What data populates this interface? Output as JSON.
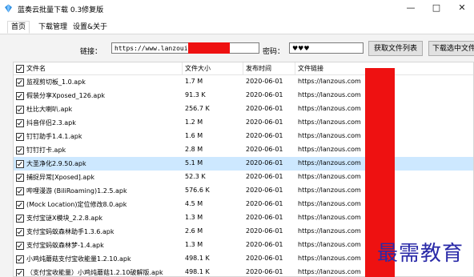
{
  "window": {
    "title": "蓝奏云批量下载 0.3修复版",
    "minimize_glyph": "—",
    "maximize_glyph": "□",
    "close_glyph": "✕"
  },
  "tabs": [
    {
      "label": "首页",
      "active": true
    },
    {
      "label": "下载管理",
      "active": false
    },
    {
      "label": "设置&关于",
      "active": false
    }
  ],
  "form": {
    "link_label": "链接：",
    "link_value": "https://www.lanzoui.com",
    "password_label": "密码：",
    "password_value": "♥♥♥",
    "get_list_button": "获取文件列表",
    "download_selected_button": "下载选中文件"
  },
  "table": {
    "headers": {
      "name": "文件名",
      "size": "文件大小",
      "date": "发布时间",
      "link": "文件链接"
    },
    "rows": [
      {
        "name": "监视剪切板_1.0.apk",
        "size": "1.7 M",
        "date": "2020-06-01",
        "link": "https://lanzous.com",
        "checked": true
      },
      {
        "name": "假装分享Xposed_126.apk",
        "size": "91.3 K",
        "date": "2020-06-01",
        "link": "https://lanzous.com",
        "checked": true
      },
      {
        "name": "杜比大喇叭.apk",
        "size": "256.7 K",
        "date": "2020-06-01",
        "link": "https://lanzous.com",
        "checked": true
      },
      {
        "name": "抖音伴侣2.3.apk",
        "size": "1.2 M",
        "date": "2020-06-01",
        "link": "https://lanzous.com",
        "checked": true
      },
      {
        "name": "钉钉助手1.4.1.apk",
        "size": "1.6 M",
        "date": "2020-06-01",
        "link": "https://lanzous.com",
        "checked": true
      },
      {
        "name": "钉钉打卡.apk",
        "size": "2.8 M",
        "date": "2020-06-01",
        "link": "https://lanzous.com",
        "checked": true
      },
      {
        "name": "大圣净化2.9.50.apk",
        "size": "5.1 M",
        "date": "2020-06-01",
        "link": "https://lanzous.com",
        "checked": true,
        "selected": true
      },
      {
        "name": "捕捉异常[Xposed].apk",
        "size": "52.3 K",
        "date": "2020-06-01",
        "link": "https://lanzous.com",
        "checked": true
      },
      {
        "name": "哔哩漫游 (BiliRoaming)1.2.5.apk",
        "size": "576.6 K",
        "date": "2020-06-01",
        "link": "https://lanzous.com",
        "checked": true
      },
      {
        "name": "(Mock Location)定位修改8.0.apk",
        "size": "4.5 M",
        "date": "2020-06-01",
        "link": "https://lanzous.com",
        "checked": true
      },
      {
        "name": "支付宝谜X模块_2.2.8.apk",
        "size": "1.3 M",
        "date": "2020-06-01",
        "link": "https://lanzous.com",
        "checked": true
      },
      {
        "name": "支付宝蚂蚁森林助手1.3.6.apk",
        "size": "2.6 M",
        "date": "2020-06-01",
        "link": "https://lanzous.com",
        "checked": true
      },
      {
        "name": "支付宝蚂蚁森林梦-1.4.apk",
        "size": "1.3 M",
        "date": "2020-06-01",
        "link": "https://lanzous.com",
        "checked": true
      },
      {
        "name": "小鸡炖蘑菇支付宝收能量1.2.10.apk",
        "size": "498.1 K",
        "date": "2020-06-01",
        "link": "https://lanzous.com",
        "checked": true
      },
      {
        "name": "（支付宝收能量）小鸡炖蘑菇1.2.10破解版.apk",
        "size": "498.1 K",
        "date": "2020-06-01",
        "link": "https://lanzous.com",
        "checked": true
      }
    ]
  },
  "watermark": "最需教育",
  "colors": {
    "selected_row": "#cde8ff",
    "redaction": "#ee1111",
    "watermark": "#2a2aa8"
  }
}
